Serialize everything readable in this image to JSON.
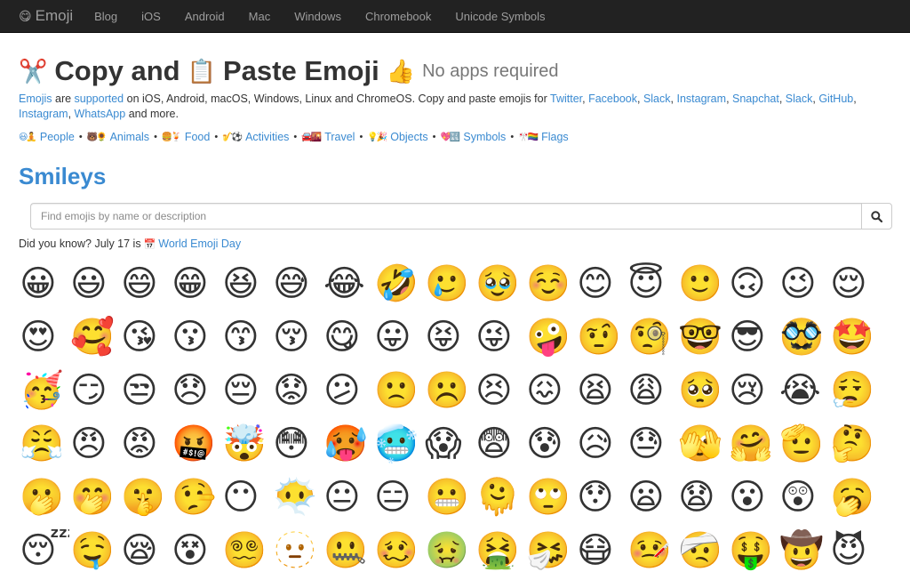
{
  "navbar": {
    "brand_icon": "😋",
    "brand": "Emoji",
    "links": [
      "Blog",
      "iOS",
      "Android",
      "Mac",
      "Windows",
      "Chromebook",
      "Unicode Symbols"
    ]
  },
  "header": {
    "icon_scissors": "✂️",
    "copy": "Copy and",
    "icon_clipboard": "📋",
    "paste": "Paste Emoji",
    "icon_thumbs": "👍",
    "subtitle": "No apps required"
  },
  "intro": {
    "link_emojis": "Emojis",
    "text1": " are ",
    "link_supported": "supported",
    "text2": " on iOS, Android, macOS, Windows, Linux and ChromeOS. Copy and paste emojis for ",
    "apps": [
      "Twitter",
      "Facebook",
      "Slack",
      "Instagram",
      "Snapchat",
      "Slack",
      "GitHub",
      "Instagram",
      "WhatsApp"
    ],
    "text_end": " and more."
  },
  "categories": [
    {
      "icons": "😃🧘",
      "label": "People"
    },
    {
      "icons": "🐻🌻",
      "label": "Animals"
    },
    {
      "icons": "🍔🍹",
      "label": "Food"
    },
    {
      "icons": "🎷⚽️",
      "label": "Activities"
    },
    {
      "icons": "🚘🌇",
      "label": "Travel"
    },
    {
      "icons": "💡🎉",
      "label": "Objects"
    },
    {
      "icons": "💖🔣",
      "label": "Symbols"
    },
    {
      "icons": "🎌🏳️‍🌈",
      "label": "Flags"
    }
  ],
  "category_separator": "•",
  "section_title": "Smileys",
  "search": {
    "placeholder": "Find emojis by name or description",
    "value": "",
    "button_icon": "search-icon"
  },
  "did_you_know": {
    "text": "Did you know? July 17 is",
    "icon": "📅",
    "link": "World Emoji Day"
  },
  "emojis": [
    "😀",
    "😃",
    "😄",
    "😁",
    "😆",
    "😅",
    "😂",
    "🤣",
    "🥲",
    "🥹",
    "☺️",
    "😊",
    "😇",
    "🙂",
    "🙃",
    "😉",
    "😌",
    "😍",
    "🥰",
    "😘",
    "😗",
    "😙",
    "😚",
    "😋",
    "😛",
    "😝",
    "😜",
    "🤪",
    "🤨",
    "🧐",
    "🤓",
    "😎",
    "🥸",
    "🤩",
    "🥳",
    "😏",
    "😒",
    "😞",
    "😔",
    "😟",
    "😕",
    "🙁",
    "☹️",
    "😣",
    "😖",
    "😫",
    "😩",
    "🥺",
    "😢",
    "😭",
    "😮‍💨",
    "😤",
    "😠",
    "😡",
    "🤬",
    "🤯",
    "😳",
    "🥵",
    "🥶",
    "😱",
    "😨",
    "😰",
    "😥",
    "😓",
    "🫣",
    "🤗",
    "🫡",
    "🤔",
    "🫢",
    "🤭",
    "🤫",
    "🤥",
    "😶",
    "😶‍🌫️",
    "😐",
    "😑",
    "😬",
    "🫠",
    "🙄",
    "😯",
    "😦",
    "😧",
    "😮",
    "😲",
    "🥱",
    "😴",
    "🤤",
    "😪",
    "😵",
    "😵‍💫",
    "🫥",
    "🤐",
    "🥴",
    "🤢",
    "🤮",
    "🤧",
    "😷",
    "🤒",
    "🤕",
    "🤑",
    "🤠",
    "😈"
  ],
  "colors": {
    "navbar_bg": "#222222",
    "nav_text": "#9d9d9d",
    "link": "#3a8ad1",
    "heading_section": "#3a8ad1",
    "subtitle": "#777777"
  }
}
